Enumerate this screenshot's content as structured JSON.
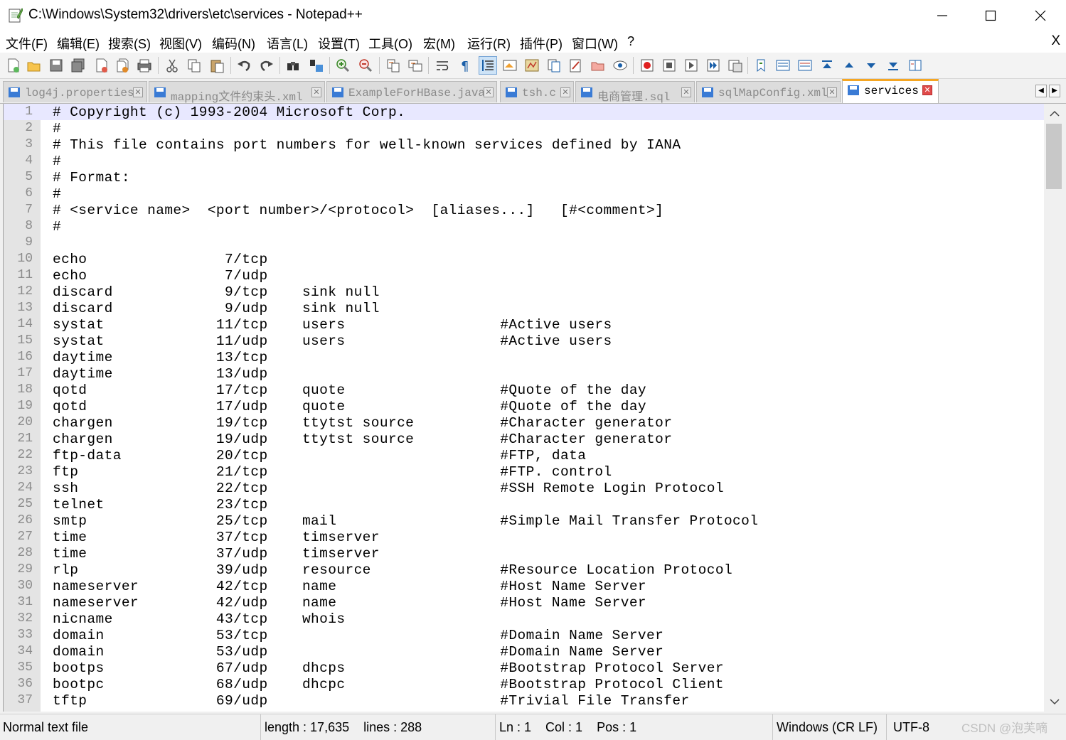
{
  "window": {
    "title": "C:\\Windows\\System32\\drivers\\etc\\services - Notepad++",
    "minimize_glyph": "—",
    "maximize_glyph": "☐",
    "close_glyph": "✕"
  },
  "menu": {
    "items": [
      "文件(F)",
      "编辑(E)",
      "搜索(S)",
      "视图(V)",
      "编码(N)",
      "语言(L)",
      "设置(T)",
      "工具(O)",
      "宏(M)",
      "运行(R)",
      "插件(P)",
      "窗口(W)",
      "?"
    ],
    "close_doc": "X"
  },
  "toolbar": {
    "icons": [
      "new-file-icon",
      "open-file-icon",
      "save-icon",
      "save-all-icon",
      "close-icon",
      "close-all-icon",
      "print-icon",
      "cut-icon",
      "copy-icon",
      "paste-icon",
      "undo-icon",
      "redo-icon",
      "find-icon",
      "replace-icon",
      "zoom-in-icon",
      "zoom-out-icon",
      "sync-vertical-icon",
      "sync-horizontal-icon",
      "word-wrap-icon",
      "show-all-chars-icon",
      "indent-guide-icon",
      "lang-udl-icon",
      "document-map-icon",
      "function-list-icon",
      "folder-workspace-icon",
      "folder-icon",
      "monitoring-icon",
      "record-macro-icon",
      "stop-macro-icon",
      "play-macro-icon",
      "run-macro-multiple-icon",
      "save-macro-icon",
      "bookmark-next-icon",
      "compare-icon",
      "compare-alt-icon",
      "first-diff-icon",
      "prev-diff-icon",
      "next-diff-icon",
      "last-diff-icon",
      "diff-panel-icon"
    ]
  },
  "tabs": [
    {
      "label": "log4j.properties",
      "active": false
    },
    {
      "label": "mapping文件约束头.xml",
      "active": false
    },
    {
      "label": "ExampleForHBase.java",
      "active": false
    },
    {
      "label": "tsh.c",
      "active": false
    },
    {
      "label": "电商管理.sql",
      "active": false
    },
    {
      "label": "sqlMapConfig.xml",
      "active": false
    },
    {
      "label": "services",
      "active": true
    }
  ],
  "tab_scroll": {
    "left": "◀",
    "right": "▶"
  },
  "editor": {
    "current_line": 1,
    "lines": [
      {
        "num": "1",
        "text": "# Copyright (c) 1993-2004 Microsoft Corp."
      },
      {
        "num": "2",
        "text": "#"
      },
      {
        "num": "3",
        "text": "# This file contains port numbers for well-known services defined by IANA"
      },
      {
        "num": "4",
        "text": "#"
      },
      {
        "num": "5",
        "text": "# Format:"
      },
      {
        "num": "6",
        "text": "#"
      },
      {
        "num": "7",
        "text": "# <service name>  <port number>/<protocol>  [aliases...]   [#<comment>]"
      },
      {
        "num": "8",
        "text": "#"
      },
      {
        "num": "9",
        "text": ""
      },
      {
        "num": "10",
        "text": "echo                7/tcp"
      },
      {
        "num": "11",
        "text": "echo                7/udp"
      },
      {
        "num": "12",
        "text": "discard             9/tcp    sink null"
      },
      {
        "num": "13",
        "text": "discard             9/udp    sink null"
      },
      {
        "num": "14",
        "text": "systat             11/tcp    users                  #Active users"
      },
      {
        "num": "15",
        "text": "systat             11/udp    users                  #Active users"
      },
      {
        "num": "16",
        "text": "daytime            13/tcp"
      },
      {
        "num": "17",
        "text": "daytime            13/udp"
      },
      {
        "num": "18",
        "text": "qotd               17/tcp    quote                  #Quote of the day"
      },
      {
        "num": "19",
        "text": "qotd               17/udp    quote                  #Quote of the day"
      },
      {
        "num": "20",
        "text": "chargen            19/tcp    ttytst source          #Character generator"
      },
      {
        "num": "21",
        "text": "chargen            19/udp    ttytst source          #Character generator"
      },
      {
        "num": "22",
        "text": "ftp-data           20/tcp                           #FTP, data"
      },
      {
        "num": "23",
        "text": "ftp                21/tcp                           #FTP. control"
      },
      {
        "num": "24",
        "text": "ssh                22/tcp                           #SSH Remote Login Protocol"
      },
      {
        "num": "25",
        "text": "telnet             23/tcp"
      },
      {
        "num": "26",
        "text": "smtp               25/tcp    mail                   #Simple Mail Transfer Protocol"
      },
      {
        "num": "27",
        "text": "time               37/tcp    timserver"
      },
      {
        "num": "28",
        "text": "time               37/udp    timserver"
      },
      {
        "num": "29",
        "text": "rlp                39/udp    resource               #Resource Location Protocol"
      },
      {
        "num": "30",
        "text": "nameserver         42/tcp    name                   #Host Name Server"
      },
      {
        "num": "31",
        "text": "nameserver         42/udp    name                   #Host Name Server"
      },
      {
        "num": "32",
        "text": "nicname            43/tcp    whois"
      },
      {
        "num": "33",
        "text": "domain             53/tcp                           #Domain Name Server"
      },
      {
        "num": "34",
        "text": "domain             53/udp                           #Domain Name Server"
      },
      {
        "num": "35",
        "text": "bootps             67/udp    dhcps                  #Bootstrap Protocol Server"
      },
      {
        "num": "36",
        "text": "bootpc             68/udp    dhcpc                  #Bootstrap Protocol Client"
      },
      {
        "num": "37",
        "text": "tftp               69/udp                           #Trivial File Transfer"
      }
    ]
  },
  "scrollbar": {
    "up": "▲",
    "down": "▼"
  },
  "status": {
    "file_type": "Normal text file",
    "length": "length : 17,635    lines : 288",
    "position": "Ln : 1    Col : 1    Pos : 1",
    "eol": "Windows (CR LF)",
    "encoding": "UTF-8",
    "watermark": "CSDN @泡芙嘀"
  },
  "colors": {
    "accent_tab": "#f5a623",
    "current_line": "#e8e8ff",
    "gutter": "#e4e4e4"
  }
}
